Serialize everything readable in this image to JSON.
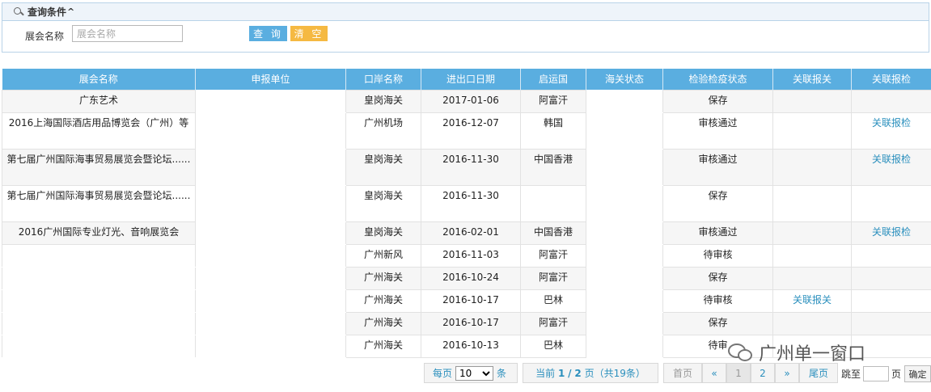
{
  "query": {
    "title": "查询条件",
    "collapse_glyph": "^",
    "field_label": "展会名称",
    "field_placeholder": "展会名称",
    "search_label": "查 询",
    "clear_label": "清 空"
  },
  "table": {
    "columns": [
      "展会名称",
      "申报单位",
      "口岸名称",
      "进出口日期",
      "启运国",
      "海关状态",
      "检验检疫状态",
      "关联报关",
      "关联报检"
    ],
    "rows": [
      {
        "name": "广东艺术",
        "unit": "",
        "port": "皇岗海关",
        "date": "2017-01-06",
        "country": "阿富汗",
        "customs": "",
        "inspection": "保存",
        "link_customs": "",
        "link_inspection": ""
      },
      {
        "name": "2016上海国际酒店用品博览会（广州）等",
        "unit": "",
        "port": "广州机场",
        "date": "2016-12-07",
        "country": "韩国",
        "customs": "",
        "inspection": "审核通过",
        "link_customs": "",
        "link_inspection": "关联报检"
      },
      {
        "name": "第七届广州国际海事贸易展览会暨论坛......",
        "unit": "",
        "port": "皇岗海关",
        "date": "2016-11-30",
        "country": "中国香港",
        "customs": "",
        "inspection": "审核通过",
        "link_customs": "",
        "link_inspection": "关联报检"
      },
      {
        "name": "第七届广州国际海事贸易展览会暨论坛......",
        "unit": "",
        "port": "皇岗海关",
        "date": "2016-11-30",
        "country": "",
        "customs": "",
        "inspection": "保存",
        "link_customs": "",
        "link_inspection": ""
      },
      {
        "name": "2016广州国际专业灯光、音响展览会",
        "unit": "",
        "port": "皇岗海关",
        "date": "2016-02-01",
        "country": "中国香港",
        "customs": "",
        "inspection": "审核通过",
        "link_customs": "",
        "link_inspection": "关联报检"
      },
      {
        "name": "",
        "unit": "",
        "port": "广州新风",
        "date": "2016-11-03",
        "country": "阿富汗",
        "customs": "",
        "inspection": "待审核",
        "link_customs": "",
        "link_inspection": ""
      },
      {
        "name": "",
        "unit": "",
        "port": "广州海关",
        "date": "2016-10-24",
        "country": "阿富汗",
        "customs": "",
        "inspection": "保存",
        "link_customs": "",
        "link_inspection": ""
      },
      {
        "name": "",
        "unit": "",
        "port": "广州海关",
        "date": "2016-10-17",
        "country": "巴林",
        "customs": "",
        "inspection": "待审核",
        "link_customs": "关联报关",
        "link_inspection": ""
      },
      {
        "name": "",
        "unit": "",
        "port": "广州海关",
        "date": "2016-10-17",
        "country": "阿富汗",
        "customs": "",
        "inspection": "保存",
        "link_customs": "",
        "link_inspection": ""
      },
      {
        "name": "",
        "unit": "",
        "port": "广州海关",
        "date": "2016-10-13",
        "country": "巴林",
        "customs": "",
        "inspection": "待审",
        "link_customs": "",
        "link_inspection": ""
      }
    ]
  },
  "pager": {
    "per_page_prefix": "每页",
    "per_page_value": "10",
    "per_page_suffix": "条",
    "current_prefix": "当前",
    "current_page": "1",
    "separator": "/",
    "total_pages": "2",
    "page_word": "页",
    "total_text": "（共19条）",
    "first_label": "首页",
    "prev_label": "«",
    "page1": "1",
    "page2": "2",
    "next_label": "»",
    "last_label": "尾页",
    "jump_prefix": "跳至",
    "jump_suffix": "页",
    "confirm_label": "确定"
  },
  "watermark": {
    "text": "广州单一窗口"
  }
}
